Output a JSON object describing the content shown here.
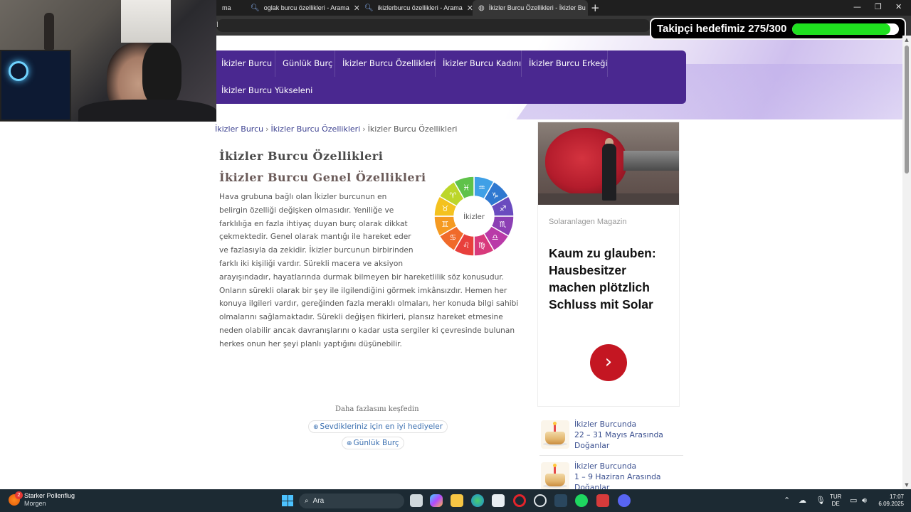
{
  "browser": {
    "tabs": [
      {
        "title": "ma",
        "icon": "search-icon"
      },
      {
        "title": "oglak burcu özellikleri - Arama",
        "icon": "search-icon"
      },
      {
        "title": "ikizlerburcu özellikleri - Arama",
        "icon": "search-icon"
      },
      {
        "title": "İkizler Burcu Özellikleri - İkizler Bu",
        "icon": "globe-icon"
      }
    ],
    "url_fragment": "l"
  },
  "goal": {
    "label": "Takipçi hedefimiz 275/300",
    "current": 275,
    "target": 300,
    "bar_color": "#1fe01f"
  },
  "nav": {
    "items": [
      "İkizler Burcu",
      "Günlük Burç",
      "İkizler Burcu Özellikleri",
      "İkizler Burcu Kadını",
      "İkizler Burcu Erkeği",
      "İkizler Burcu Yükseleni"
    ],
    "background": "#4a2890"
  },
  "breadcrumb": {
    "items": [
      "İkizler Burcu",
      "İkizler Burcu Özellikleri"
    ],
    "current": "İkizler Burcu Özellikleri",
    "separator": "›"
  },
  "article": {
    "title": "İkizler Burcu Özellikleri",
    "subtitle": "İkizler Burcu Genel Özellikleri",
    "body": "Hava grubuna bağlı olan İkizler burcunun en belirgin özelliği değişken olmasıdır. Yeniliğe ve farklılığa en fazla ihtiyaç duyan burç olarak dikkat çekmektedir. Genel olarak mantığı ile hareket eder ve fazlasıyla da zekidir. İkizler burcunun birbirinden farklı iki kişiliği vardır. Sürekli macera ve aksiyon arayışındadır, hayatlarında durmak bilmeyen bir hareketlilik söz konusudur. Onların sürekli olarak bir şey ile ilgilendiğini görmek imkânsızdır. Hemen her konuya ilgileri vardır, gereğinden fazla meraklı olmaları, her konuda bilgi sahibi olmalarını sağlamaktadır. Sürekli değişen fikirleri, plansız hareket etmesine neden olabilir ancak davranışlarını o kadar usta sergiler ki çevresinde bulunan herkes onun her şeyi planlı yaptığını düşünebilir.",
    "wheel_label": "İkizler",
    "wheel_signs": [
      "♒",
      "♑",
      "♐",
      "♏",
      "♎",
      "♍",
      "♌",
      "♋",
      "♊",
      "♉",
      "♈",
      "♓"
    ],
    "wheel_colors": [
      "#3fa0e6",
      "#2f78d0",
      "#6a4bbf",
      "#8c3fb4",
      "#b93aa8",
      "#d83a7c",
      "#e8403c",
      "#f06a2a",
      "#f59a22",
      "#f4c21f",
      "#bcd62a",
      "#5fc24a"
    ]
  },
  "more": {
    "label": "Daha fazlasını keşfedin",
    "links": [
      "Sevdikleriniz için en iyi hediyeler",
      "Günlük Burç"
    ]
  },
  "ad": {
    "source": "Solaranlagen Magazin",
    "title": "Kaum zu glauben: Hausbesitzer machen plötzlich Schluss mit Solar",
    "cta_icon": "chevron-right-icon",
    "cta_color": "#c41622"
  },
  "sidebar": {
    "items": [
      {
        "line1": "İkizler Burcunda",
        "line2": "22 – 31 Mayıs Arasında",
        "line3": "Doğanlar"
      },
      {
        "line1": "İkizler Burcunda",
        "line2": "1 – 9 Haziran Arasında",
        "line3": "Doğanlar"
      }
    ]
  },
  "taskbar": {
    "weather_title": "Starker Pollenflug",
    "weather_sub": "Morgen",
    "weather_badge": "2",
    "search_placeholder": "Ara",
    "lang_top": "TUR",
    "lang_bottom": "DE",
    "time": "17:07",
    "date": "6.09.2025"
  }
}
